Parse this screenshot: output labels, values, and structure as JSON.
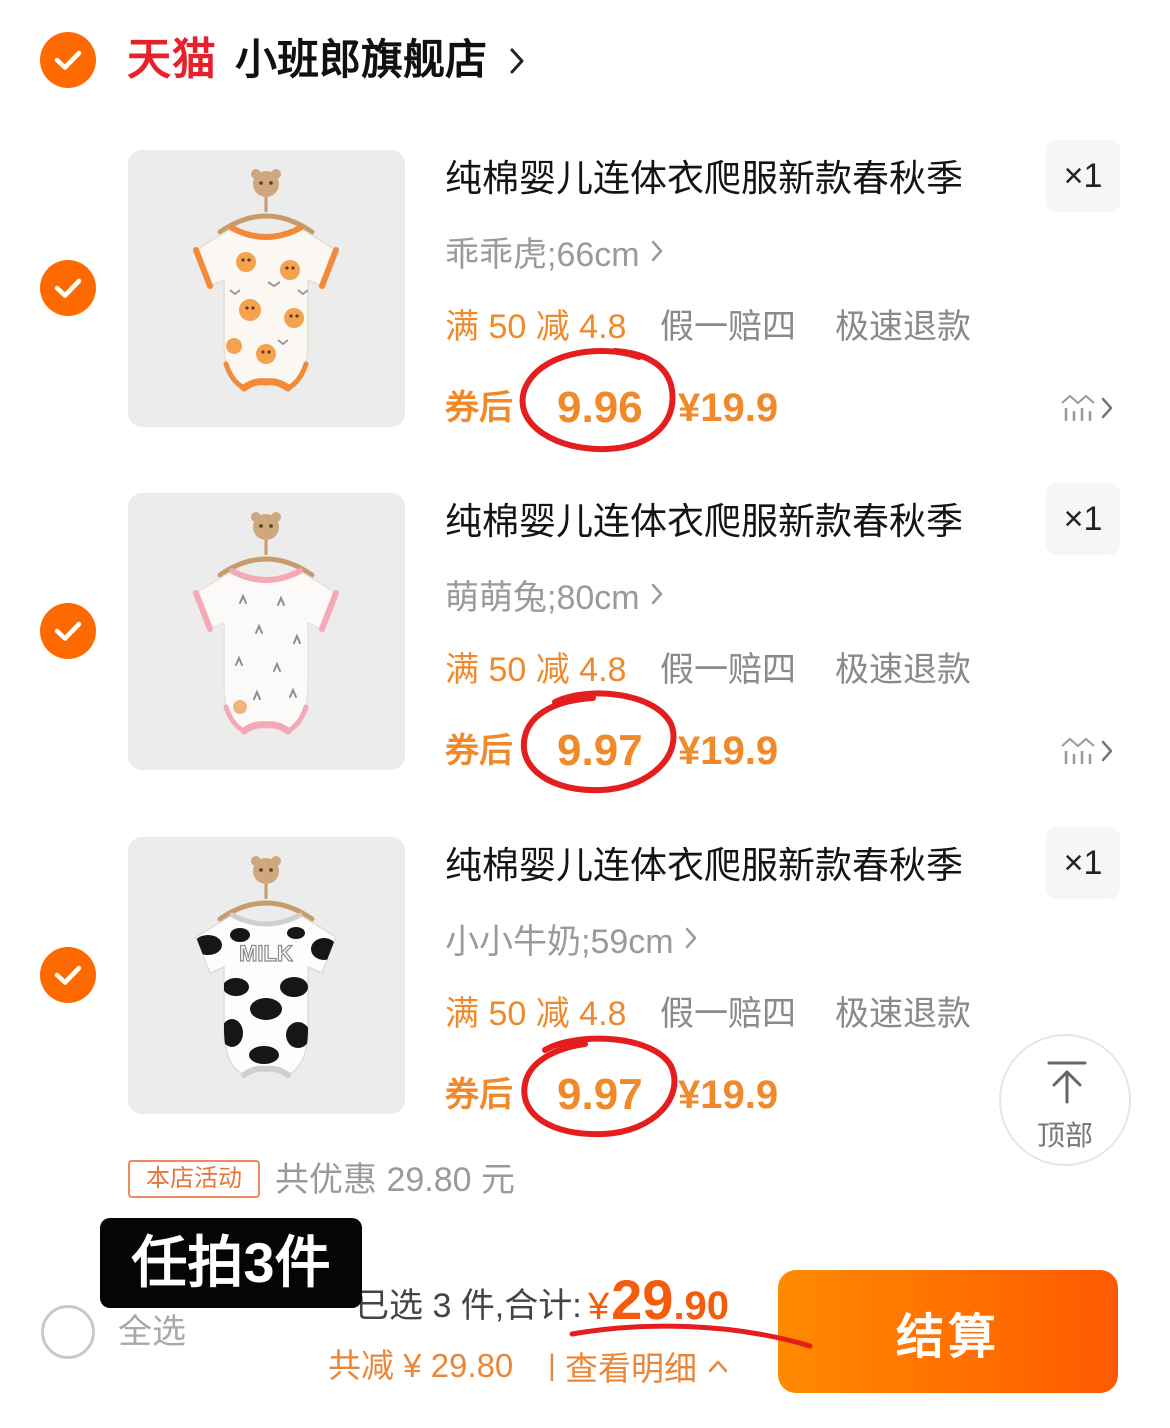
{
  "store": {
    "platform_logo": "天猫",
    "name": "小班郎旗舰店",
    "checked": true
  },
  "items": [
    {
      "checked": true,
      "title": "纯棉婴儿连体衣爬服新款春秋季",
      "quantity": "×1",
      "variant": "乖乖虎;66cm",
      "promo_tag": "满 50 减 4.8",
      "service_tags": [
        "假一赔四",
        "极速退款"
      ],
      "price_label": "券后",
      "coupon_price": "9.96",
      "original_price": "¥19.9"
    },
    {
      "checked": true,
      "title": "纯棉婴儿连体衣爬服新款春秋季",
      "quantity": "×1",
      "variant": "萌萌兔;80cm",
      "promo_tag": "满 50 减 4.8",
      "service_tags": [
        "假一赔四",
        "极速退款"
      ],
      "price_label": "券后",
      "coupon_price": "9.97",
      "original_price": "¥19.9"
    },
    {
      "checked": true,
      "title": "纯棉婴儿连体衣爬服新款春秋季",
      "quantity": "×1",
      "variant": "小小牛奶;59cm",
      "promo_tag": "满 50 减 4.8",
      "service_tags": [
        "假一赔四",
        "极速退款"
      ],
      "price_label": "券后",
      "coupon_price": "9.97",
      "original_price": "¥19.9",
      "image_text": "MILK"
    }
  ],
  "shop_promo": {
    "badge": "本店活动",
    "text": "共优惠 29.80 元"
  },
  "overlay_caption": "任拍3件",
  "back_to_top": {
    "label": "顶部"
  },
  "footer": {
    "select_all_label": "全选",
    "select_all_checked": false,
    "selected_summary": "已选 3 件,合计:",
    "total_currency": "¥",
    "total_int": "29",
    "total_dec": ".90",
    "discount": "共减 ¥ 29.80",
    "separator": "|",
    "details_link": "查看明细",
    "checkout_label": "结算"
  },
  "colors": {
    "accent": "#FF6A00",
    "price": "#F0892A",
    "brand": "#E6212C",
    "total": "#F45B0A",
    "annotation": "#E41E1E"
  }
}
